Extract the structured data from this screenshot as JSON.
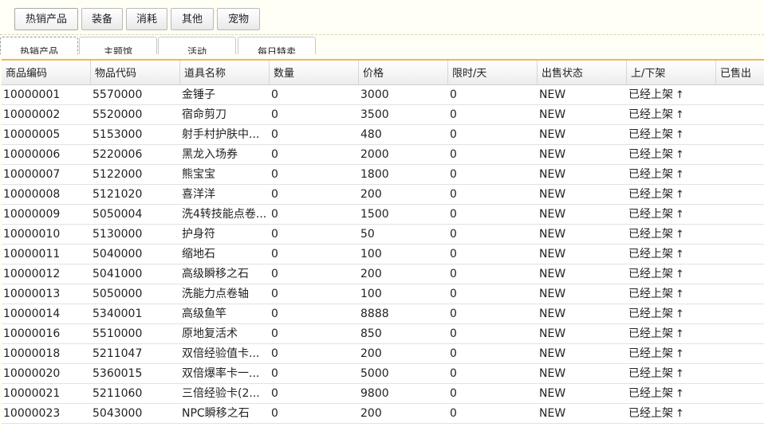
{
  "top_tabs": [
    "热销产品",
    "装备",
    "消耗",
    "其他",
    "宠物"
  ],
  "sub_tabs": [
    "热销产品",
    "主题馆",
    "活动",
    "每日特卖"
  ],
  "columns": [
    "商品编码",
    "物品代码",
    "道具名称",
    "数量",
    "价格",
    "限时/天",
    "出售状态",
    "上/下架",
    "已售出"
  ],
  "up_arrow": "↑",
  "rows": [
    {
      "code": "10000001",
      "item": "5570000",
      "name": "金锤子",
      "qty": "0",
      "price": "3000",
      "days": "0",
      "status": "NEW",
      "shelf": "已经上架"
    },
    {
      "code": "10000002",
      "item": "5520000",
      "name": "宿命剪刀",
      "qty": "0",
      "price": "3500",
      "days": "0",
      "status": "NEW",
      "shelf": "已经上架"
    },
    {
      "code": "10000005",
      "item": "5153000",
      "name": "射手村护肤中...",
      "qty": "0",
      "price": "480",
      "days": "0",
      "status": "NEW",
      "shelf": "已经上架"
    },
    {
      "code": "10000006",
      "item": "5220006",
      "name": "黑龙入场券",
      "qty": "0",
      "price": "2000",
      "days": "0",
      "status": "NEW",
      "shelf": "已经上架"
    },
    {
      "code": "10000007",
      "item": "5122000",
      "name": "熊宝宝",
      "qty": "0",
      "price": "1800",
      "days": "0",
      "status": "NEW",
      "shelf": "已经上架"
    },
    {
      "code": "10000008",
      "item": "5121020",
      "name": "喜洋洋",
      "qty": "0",
      "price": "200",
      "days": "0",
      "status": "NEW",
      "shelf": "已经上架"
    },
    {
      "code": "10000009",
      "item": "5050004",
      "name": "洗4转技能点卷...",
      "qty": "0",
      "price": "1500",
      "days": "0",
      "status": "NEW",
      "shelf": "已经上架"
    },
    {
      "code": "10000010",
      "item": "5130000",
      "name": "护身符",
      "qty": "0",
      "price": "50",
      "days": "0",
      "status": "NEW",
      "shelf": "已经上架"
    },
    {
      "code": "10000011",
      "item": "5040000",
      "name": "缩地石",
      "qty": "0",
      "price": "100",
      "days": "0",
      "status": "NEW",
      "shelf": "已经上架"
    },
    {
      "code": "10000012",
      "item": "5041000",
      "name": "高级瞬移之石",
      "qty": "0",
      "price": "200",
      "days": "0",
      "status": "NEW",
      "shelf": "已经上架"
    },
    {
      "code": "10000013",
      "item": "5050000",
      "name": "洗能力点卷轴",
      "qty": "0",
      "price": "100",
      "days": "0",
      "status": "NEW",
      "shelf": "已经上架"
    },
    {
      "code": "10000014",
      "item": "5340001",
      "name": "高级鱼竿",
      "qty": "0",
      "price": "8888",
      "days": "0",
      "status": "NEW",
      "shelf": "已经上架"
    },
    {
      "code": "10000016",
      "item": "5510000",
      "name": "原地复活术",
      "qty": "0",
      "price": "850",
      "days": "0",
      "status": "NEW",
      "shelf": "已经上架"
    },
    {
      "code": "10000018",
      "item": "5211047",
      "name": "双倍经验值卡...",
      "qty": "0",
      "price": "200",
      "days": "0",
      "status": "NEW",
      "shelf": "已经上架"
    },
    {
      "code": "10000020",
      "item": "5360015",
      "name": "双倍爆率卡一...",
      "qty": "0",
      "price": "5000",
      "days": "0",
      "status": "NEW",
      "shelf": "已经上架"
    },
    {
      "code": "10000021",
      "item": "5211060",
      "name": "三倍经验卡(2...",
      "qty": "0",
      "price": "9800",
      "days": "0",
      "status": "NEW",
      "shelf": "已经上架"
    },
    {
      "code": "10000023",
      "item": "5043000",
      "name": "NPC瞬移之石",
      "qty": "0",
      "price": "200",
      "days": "0",
      "status": "NEW",
      "shelf": "已经上架"
    }
  ]
}
